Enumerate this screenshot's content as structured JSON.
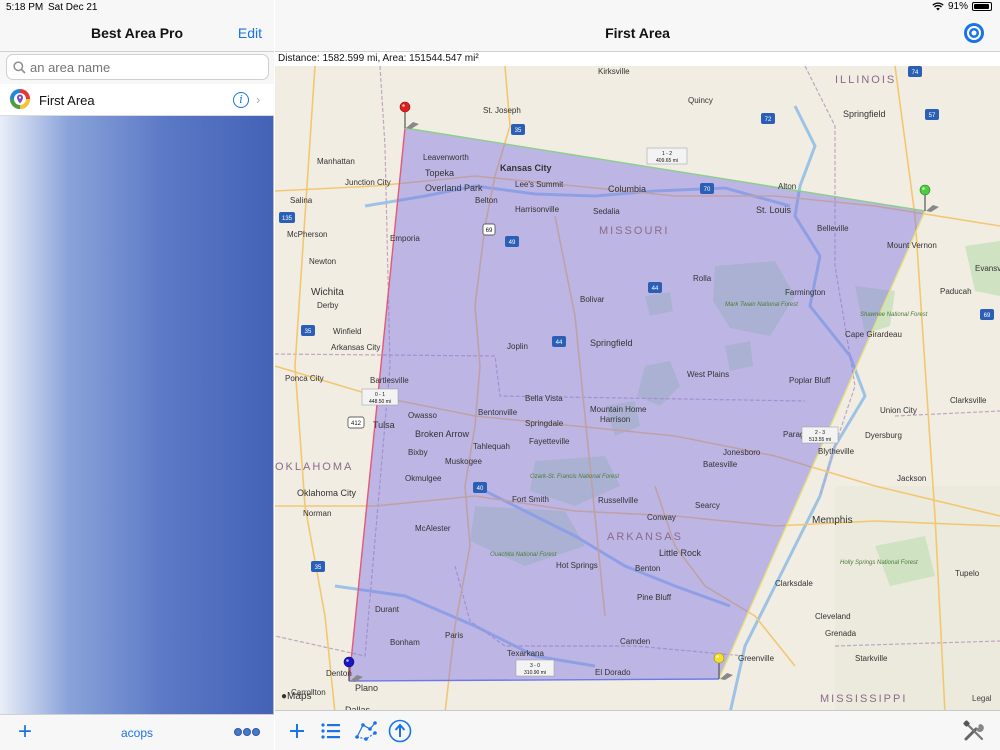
{
  "status": {
    "time": "5:18 PM",
    "date": "Sat Dec 21",
    "battery": "91%",
    "battery_level": 0.91
  },
  "sidebar": {
    "title": "Best Area Pro",
    "edit_label": "Edit",
    "search_placeholder": "an area name",
    "items": [
      {
        "label": "First Area"
      }
    ],
    "footer_center": "acops"
  },
  "main": {
    "title": "First Area",
    "info": "Distance: 1582.599 mi, Area: 151544.547 mi²",
    "maps_label": "Maps",
    "legal_label": "Legal"
  },
  "segments": [
    {
      "name": "0 - 1",
      "distance": "448.50 mi"
    },
    {
      "name": "1 - 2",
      "distance": "409.65 mi"
    },
    {
      "name": "2 - 3",
      "distance": "513.55 mi"
    },
    {
      "name": "3 - 0",
      "distance": "310.90 mi"
    }
  ],
  "map_labels": {
    "states": [
      "ILLINOIS",
      "MISSOURI",
      "ARKANSAS",
      "OKLAHOMA",
      "MISSISSIPPI"
    ],
    "cities": [
      "Kirksville",
      "Quincy",
      "Springfield",
      "St. Joseph",
      "Manhattan",
      "Topeka",
      "Leavenworth",
      "Kansas City",
      "Lee's Summit",
      "Overland Park",
      "Junction City",
      "Salina",
      "Columbia",
      "Alton",
      "St. Louis",
      "Belleville",
      "Mount Vernon",
      "Sedalia",
      "Belton",
      "Harrisonville",
      "Emporia",
      "McPherson",
      "Newton",
      "Wichita",
      "Derby",
      "Winfield",
      "Arkansas City",
      "Ponca City",
      "Bartlesville",
      "Owasso",
      "Tulsa",
      "Broken Arrow",
      "Bixby",
      "Okmulgee",
      "Muskogee",
      "Tahlequah",
      "Bentonville",
      "Bella Vista",
      "Springdale",
      "Fayetteville",
      "Joplin",
      "Springfield",
      "Bolivar",
      "Rolla",
      "Farmington",
      "Cape Girardeau",
      "Paducah",
      "Evansville",
      "Clarksville",
      "West Plains",
      "Poplar Bluff",
      "Mountain Home",
      "Harrison",
      "Jonesboro",
      "Batesville",
      "Paragould",
      "Blytheville",
      "Dyersburg",
      "Union City",
      "Jackson",
      "Memphis",
      "Searcy",
      "Fort Smith",
      "Russellville",
      "Conway",
      "Little Rock",
      "Hot Springs",
      "Benton",
      "Pine Bluff",
      "Oklahoma City",
      "Norman",
      "McAlester",
      "Durant",
      "Bonham",
      "Paris",
      "Texarkana",
      "Camden",
      "El Dorado",
      "Greenville",
      "Cleveland",
      "Grenada",
      "Starkville",
      "Tupelo",
      "Clarksdale",
      "Denton",
      "Plano",
      "Dallas",
      "Carrollton"
    ],
    "parks": [
      "Mark Twain National Forest",
      "Ozark-St. Francis National Forest",
      "Ouachita National Forest",
      "Shawnee National Forest",
      "Holly Springs National Forest"
    ]
  },
  "toolbar": {
    "items": [
      "add",
      "list",
      "polygon",
      "share"
    ],
    "tools": "tools"
  }
}
